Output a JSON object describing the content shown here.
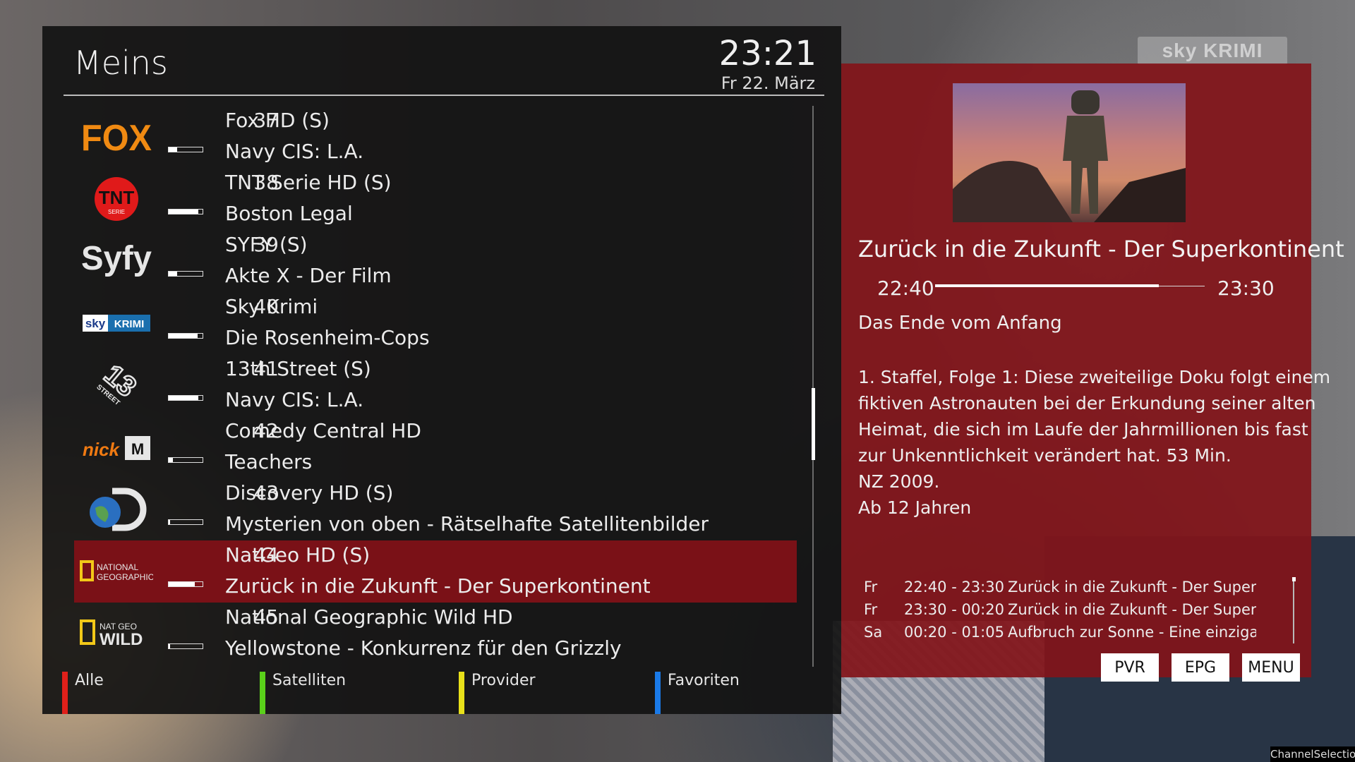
{
  "header": {
    "title": "Meins",
    "clock": "23:21",
    "date": "Fr 22. März"
  },
  "watermark": "sky KRIMI",
  "channels": [
    {
      "logo": "FOX",
      "logo_icon": "fox-logo",
      "number": "37",
      "name": "Fox HD (S)",
      "event": "Navy CIS: L.A.",
      "progress": 0.25
    },
    {
      "logo": "TNT SERIE",
      "logo_icon": "tnt-serie-logo",
      "number": "38",
      "name": "TNT Serie HD (S)",
      "event": "Boston Legal",
      "progress": 0.88
    },
    {
      "logo": "Syfy",
      "logo_icon": "syfy-logo",
      "number": "39",
      "name": "SYFY (S)",
      "event": "Akte X - Der Film",
      "progress": 0.25
    },
    {
      "logo": "sky KRIMI",
      "logo_icon": "sky-krimi-logo",
      "number": "40",
      "name": "Sky Krimi",
      "event": "Die Rosenheim-Cops",
      "progress": 0.85
    },
    {
      "logo": "13TH STREET",
      "logo_icon": "13th-street-logo",
      "number": "41",
      "name": "13th Street (S)",
      "event": "Navy CIS: L.A.",
      "progress": 0.88
    },
    {
      "logo": "nick MTV",
      "logo_icon": "nick-mtv-logo",
      "number": "42",
      "name": "Comedy Central HD",
      "event": "Teachers",
      "progress": 0.12
    },
    {
      "logo": "Discovery",
      "logo_icon": "discovery-logo",
      "number": "43",
      "name": "Discovery HD (S)",
      "event": "Mysterien von oben - Rätselhafte Satellitenbilder",
      "progress": 0.05
    },
    {
      "logo": "NATIONAL GEOGRAPHIC",
      "logo_icon": "national-geographic-logo",
      "number": "44",
      "name": "NatGeo HD (S)",
      "event": "Zurück in die Zukunft - Der Superkontinent",
      "progress": 0.78,
      "selected": true
    },
    {
      "logo": "NAT GEO WILD",
      "logo_icon": "nat-geo-wild-logo",
      "number": "45",
      "name": "National Geographic Wild HD",
      "event": "Yellowstone - Konkurrenz für den Grizzly",
      "progress": 0.05
    }
  ],
  "color_buttons": [
    {
      "label": "Alle",
      "color": "#e0201a"
    },
    {
      "label": "Satelliten",
      "color": "#5ad01a"
    },
    {
      "label": "Provider",
      "color": "#e8e01a"
    },
    {
      "label": "Favoriten",
      "color": "#1a7ae8"
    }
  ],
  "info": {
    "title": "Zurück in die Zukunft - Der Superkontinent",
    "start": "22:40",
    "end": "23:30",
    "progress": 0.83,
    "subtitle": "Das Ende vom Anfang",
    "description_lines": [
      "1. Staffel, Folge 1: Diese zweiteilige Doku folgt einem",
      "fiktiven Astronauten bei der Erkundung seiner alten",
      "Heimat, die sich im Laufe der Jahrmillionen bis fast",
      "zur Unkenntlichkeit verändert hat. 53 Min.",
      "NZ 2009.",
      "Ab 12 Jahren"
    ],
    "epg": [
      {
        "day": "Fr",
        "time": "22:40 - 23:30",
        "title": "Zurück in die Zukunft - Der Superkc"
      },
      {
        "day": "Fr",
        "time": "23:30 - 00:20",
        "title": "Zurück in die Zukunft - Der Superkc"
      },
      {
        "day": "Sa",
        "time": "00:20 - 01:05",
        "title": "Aufbruch zur Sonne - Eine einzigart"
      }
    ]
  },
  "key_buttons": {
    "pvr": "PVR",
    "epg": "EPG",
    "menu": "MENU"
  },
  "screen_name": "ChannelSelection"
}
